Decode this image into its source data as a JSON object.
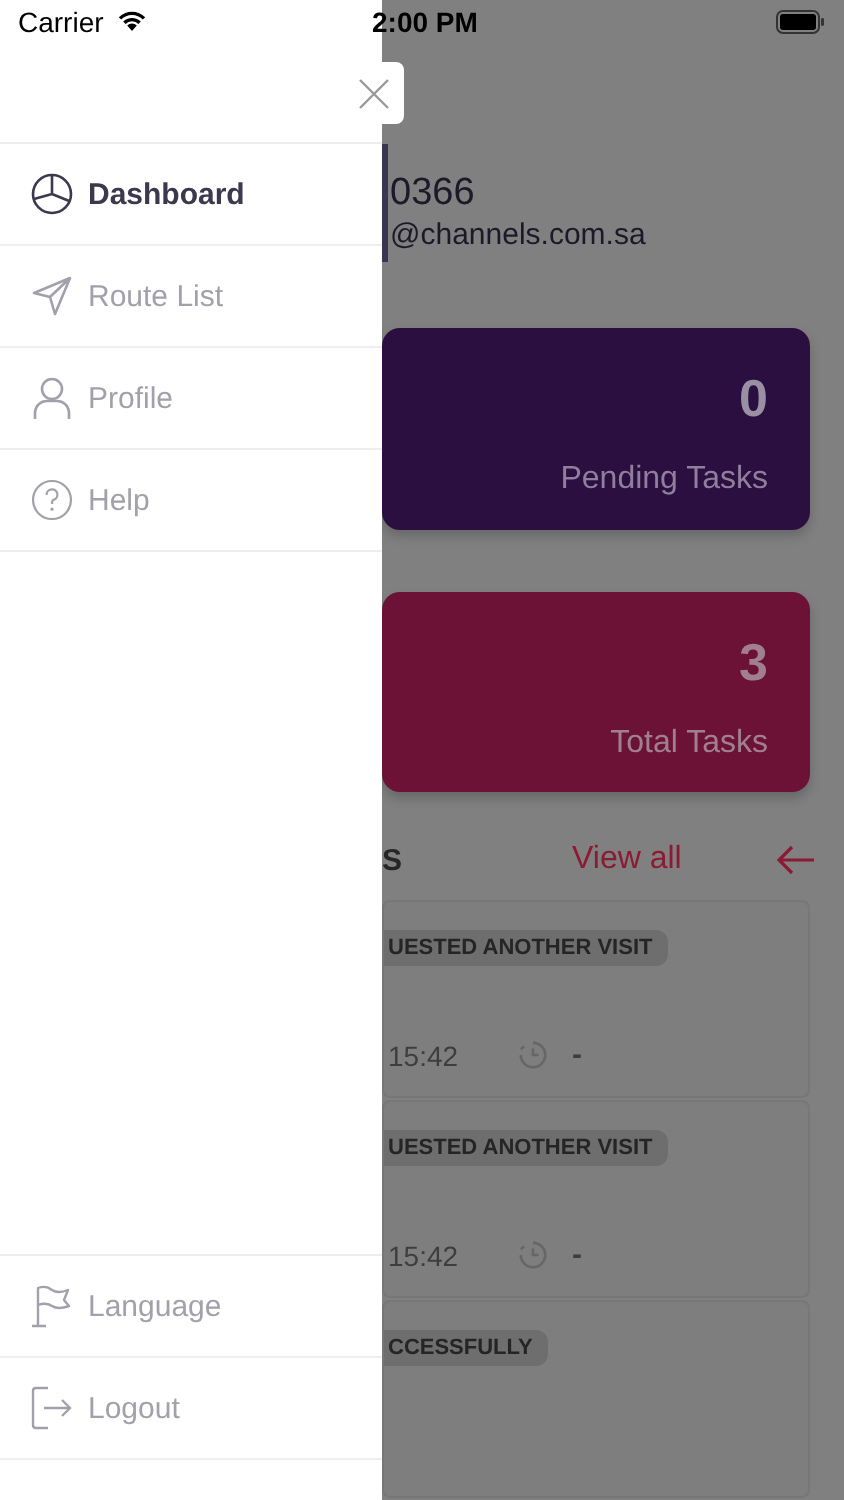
{
  "status_bar": {
    "carrier": "Carrier",
    "time": "2:00 PM"
  },
  "drawer": {
    "items": [
      {
        "label": "Dashboard",
        "kind": "pie",
        "selected": true
      },
      {
        "label": "Route List",
        "kind": "send",
        "selected": false
      },
      {
        "label": "Profile",
        "kind": "person",
        "selected": false
      },
      {
        "label": "Help",
        "kind": "help",
        "selected": false
      }
    ],
    "footer_items": [
      {
        "label": "Language",
        "kind": "flag",
        "selected": false
      },
      {
        "label": "Logout",
        "kind": "logout",
        "selected": false
      }
    ]
  },
  "header": {
    "title": "0366",
    "email": "@channels.com.sa"
  },
  "stats": [
    {
      "value": "0",
      "label": "Pending Tasks",
      "color": "#2a0f40"
    },
    {
      "value": "3",
      "label": "Total Tasks",
      "color": "#6b1236"
    }
  ],
  "tasks_section": {
    "title": "S",
    "link": "View all"
  },
  "tasks": [
    {
      "status": "UESTED ANOTHER VISIT",
      "time": "15:42",
      "duration": "-"
    },
    {
      "status": "UESTED ANOTHER VISIT",
      "time": "15:42",
      "duration": "-"
    },
    {
      "status": "CCESSFULLY"
    }
  ]
}
